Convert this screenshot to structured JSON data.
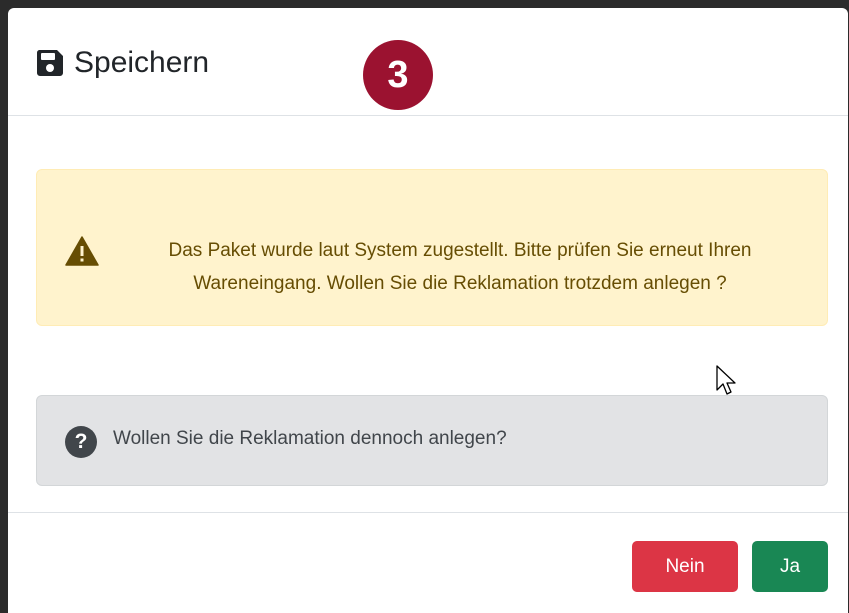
{
  "dialog": {
    "title": "Speichern",
    "title_icon": "floppy-disk-icon",
    "step_badge": "3",
    "step_badge_color": "#9b1230"
  },
  "warning": {
    "icon": "warning-triangle-icon",
    "text": "Das Paket wurde laut System zugestellt. Bitte prüfen Sie erneut Ihren Wareneingang. Wollen Sie die Reklamation trotzdem anlegen ?",
    "background": "#fff3cd"
  },
  "question": {
    "icon": "question-circle-icon",
    "icon_glyph": "?",
    "text": "Wollen Sie die Reklamation dennoch anlegen?",
    "background": "#e2e3e5"
  },
  "buttons": {
    "no_label": "Nein",
    "yes_label": "Ja",
    "no_color": "#dc3545",
    "yes_color": "#198754"
  }
}
